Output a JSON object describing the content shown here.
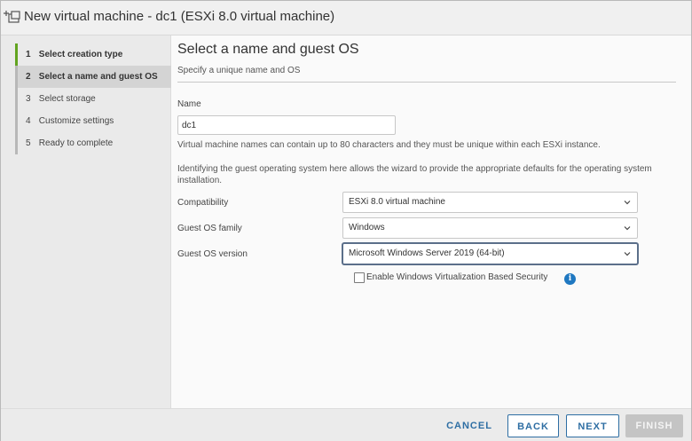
{
  "window": {
    "title": "New virtual machine - dc1 (ESXi 8.0 virtual machine)",
    "icon": "new-vm-icon"
  },
  "steps": [
    {
      "num": "1",
      "label": "Select creation type"
    },
    {
      "num": "2",
      "label": "Select a name and guest OS"
    },
    {
      "num": "3",
      "label": "Select storage"
    },
    {
      "num": "4",
      "label": "Customize settings"
    },
    {
      "num": "5",
      "label": "Ready to complete"
    }
  ],
  "page": {
    "title": "Select a name and guest OS",
    "subtitle": "Specify a unique name and OS"
  },
  "form": {
    "name_label": "Name",
    "name_value": "dc1",
    "name_help": "Virtual machine names can contain up to 80 characters and they must be unique within each ESXi instance.",
    "os_help": "Identifying the guest operating system here allows the wizard to provide the appropriate defaults for the operating system installation.",
    "compatibility_label": "Compatibility",
    "compatibility_value": "ESXi 8.0 virtual machine",
    "family_label": "Guest OS family",
    "family_value": "Windows",
    "version_label": "Guest OS version",
    "version_value": "Microsoft Windows Server 2019 (64-bit)",
    "vbs_label": "Enable Windows Virtualization Based Security",
    "vbs_checked": false
  },
  "footer": {
    "cancel": "CANCEL",
    "back": "BACK",
    "next": "NEXT",
    "finish": "FINISH"
  },
  "colors": {
    "accent": "#2e6ea3",
    "done_step": "#62a420",
    "info": "#1f78c1"
  }
}
